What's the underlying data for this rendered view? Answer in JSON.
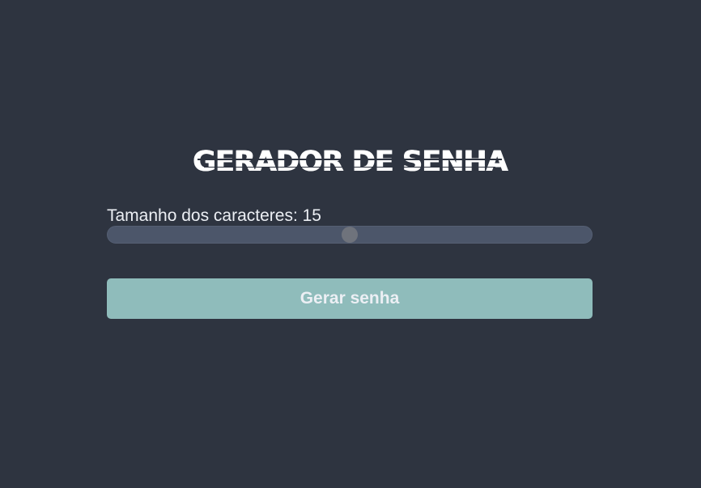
{
  "page": {
    "title": "GERADOR DE SENHA"
  },
  "length_control": {
    "label_prefix": "Tamanho dos caracteres: ",
    "value": "15",
    "slider_level": 0.5
  },
  "actions": {
    "generate_label": "Gerar senha"
  },
  "colors": {
    "background": "#2e3440",
    "track": "#4c566a",
    "thumb": "#6f737c",
    "button": "#8fbcbb",
    "text": "#eceff4"
  }
}
